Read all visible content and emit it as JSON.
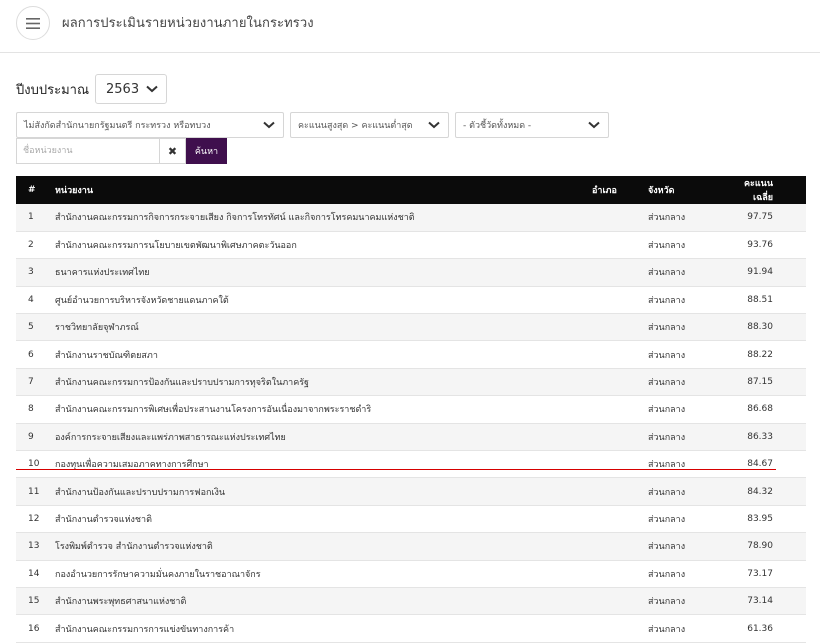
{
  "header": {
    "title": "ผลการประเมินรายหน่วยงานภายในกระทรวง",
    "menu_icon": "hamburger-menu-icon"
  },
  "year_filter": {
    "label": "ปีงบประมาณ",
    "selected": "2563"
  },
  "filters": {
    "affiliation": "ไม่สังกัดสำนักนายกรัฐมนตรี กระทรวง หรือทบวง",
    "sort": "คะแนนสูงสุด > คะแนนต่ำสุด",
    "indicator": "- ตัวชี้วัดทั้งหมด -"
  },
  "search": {
    "placeholder": "ชื่อหน่วยงาน",
    "value": "",
    "clear_label": "✖",
    "button_label": "ค้นหา"
  },
  "table": {
    "headers": {
      "num": "#",
      "agency": "หน่วยงาน",
      "district": "อำเภอ",
      "province": "จังหวัด",
      "score": "คะแนนเฉลี่ย"
    },
    "rows": [
      {
        "num": "1",
        "agency": "สำนักงานคณะกรรมการกิจการกระจายเสียง กิจการโทรทัศน์ และกิจการโทรคมนาคมแห่งชาติ",
        "district": "",
        "province": "ส่วนกลาง",
        "score": "97.75"
      },
      {
        "num": "2",
        "agency": "สำนักงานคณะกรรมการนโยบายเขตพัฒนาพิเศษภาคตะวันออก",
        "district": "",
        "province": "ส่วนกลาง",
        "score": "93.76"
      },
      {
        "num": "3",
        "agency": "ธนาคารแห่งประเทศไทย",
        "district": "",
        "province": "ส่วนกลาง",
        "score": "91.94"
      },
      {
        "num": "4",
        "agency": "ศูนย์อำนวยการบริหารจังหวัดชายแดนภาคใต้",
        "district": "",
        "province": "ส่วนกลาง",
        "score": "88.51"
      },
      {
        "num": "5",
        "agency": "ราชวิทยาลัยจุฬาภรณ์",
        "district": "",
        "province": "ส่วนกลาง",
        "score": "88.30"
      },
      {
        "num": "6",
        "agency": "สำนักงานราชบัณฑิตยสภา",
        "district": "",
        "province": "ส่วนกลาง",
        "score": "88.22"
      },
      {
        "num": "7",
        "agency": "สำนักงานคณะกรรมการป้องกันและปราบปรามการทุจริตในภาครัฐ",
        "district": "",
        "province": "ส่วนกลาง",
        "score": "87.15"
      },
      {
        "num": "8",
        "agency": "สำนักงานคณะกรรมการพิเศษเพื่อประสานงานโครงการอันเนื่องมาจากพระราชดำริ",
        "district": "",
        "province": "ส่วนกลาง",
        "score": "86.68"
      },
      {
        "num": "9",
        "agency": "องค์การกระจายเสียงและแพร่ภาพสาธารณะแห่งประเทศไทย",
        "district": "",
        "province": "ส่วนกลาง",
        "score": "86.33"
      },
      {
        "num": "10",
        "agency": "กองทุนเพื่อความเสมอภาคทางการศึกษา",
        "district": "",
        "province": "ส่วนกลาง",
        "score": "84.67"
      },
      {
        "num": "11",
        "agency": "สำนักงานป้องกันและปราบปรามการฟอกเงิน",
        "district": "",
        "province": "ส่วนกลาง",
        "score": "84.32"
      },
      {
        "num": "12",
        "agency": "สำนักงานตำรวจแห่งชาติ",
        "district": "",
        "province": "ส่วนกลาง",
        "score": "83.95"
      },
      {
        "num": "13",
        "agency": "โรงพิมพ์ตำรวจ สำนักงานตำรวจแห่งชาติ",
        "district": "",
        "province": "ส่วนกลาง",
        "score": "78.90"
      },
      {
        "num": "14",
        "agency": "กองอำนวยการรักษาความมั่นคงภายในราชอาณาจักร",
        "district": "",
        "province": "ส่วนกลาง",
        "score": "73.17"
      },
      {
        "num": "15",
        "agency": "สำนักงานพระพุทธศาสนาแห่งชาติ",
        "district": "",
        "province": "ส่วนกลาง",
        "score": "73.14"
      },
      {
        "num": "16",
        "agency": "สำนักงานคณะกรรมการการแข่งขันทางการค้า",
        "district": "",
        "province": "ส่วนกลาง",
        "score": "61.36"
      }
    ]
  },
  "colors": {
    "search_button": "#3f0f4d",
    "table_header": "#0b0b0b",
    "highlight_line": "#d60000"
  }
}
